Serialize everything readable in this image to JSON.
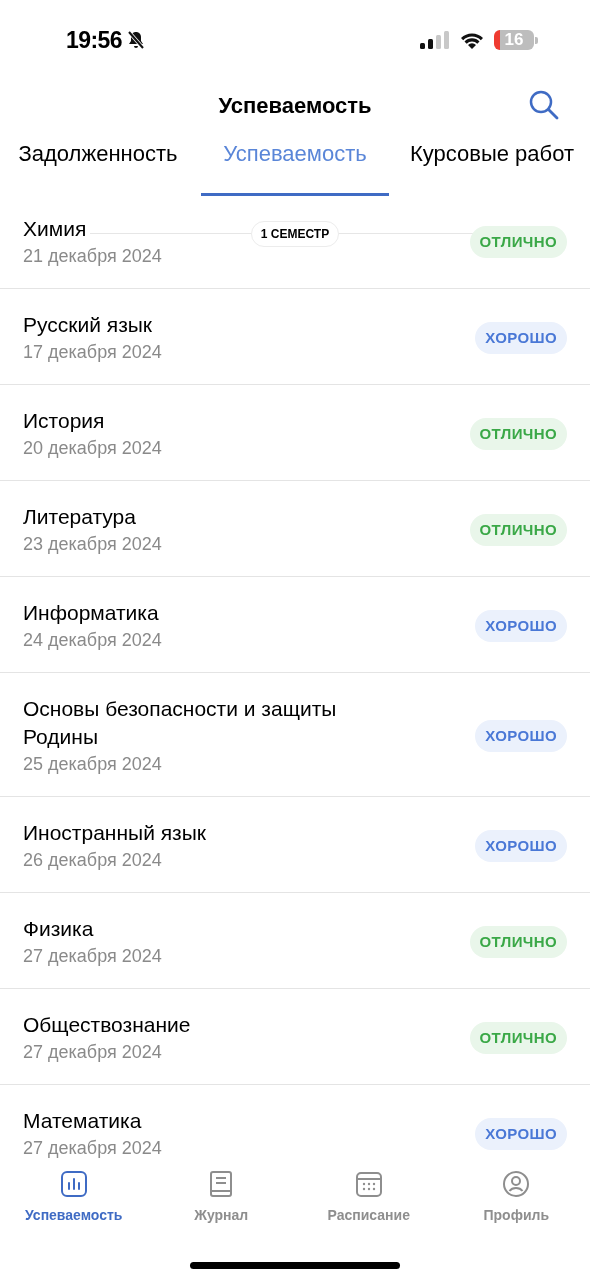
{
  "status_bar": {
    "time": "19:56",
    "battery": "16"
  },
  "header": {
    "title": "Успеваемость"
  },
  "tabs": [
    {
      "label": "Задолженность",
      "selected": false
    },
    {
      "label": "Успеваемость",
      "selected": true
    },
    {
      "label": "Курсовые работ",
      "selected": false
    }
  ],
  "section": {
    "label": "1 СЕМЕСТР"
  },
  "rows": [
    {
      "subject": "Химия",
      "date": "21 декабря 2024",
      "grade": "ОТЛИЧНО",
      "kind": "excellent"
    },
    {
      "subject": "Русский язык",
      "date": "17 декабря 2024",
      "grade": "ХОРОШО",
      "kind": "good"
    },
    {
      "subject": "История",
      "date": "20 декабря 2024",
      "grade": "ОТЛИЧНО",
      "kind": "excellent"
    },
    {
      "subject": "Литература",
      "date": "23 декабря 2024",
      "grade": "ОТЛИЧНО",
      "kind": "excellent"
    },
    {
      "subject": "Информатика",
      "date": "24 декабря 2024",
      "grade": "ХОРОШО",
      "kind": "good"
    },
    {
      "subject": "Основы безопасности и защиты Родины",
      "date": "25 декабря 2024",
      "grade": "ХОРОШО",
      "kind": "good"
    },
    {
      "subject": "Иностранный язык",
      "date": "26 декабря 2024",
      "grade": "ХОРОШО",
      "kind": "good"
    },
    {
      "subject": "Физика",
      "date": "27 декабря 2024",
      "grade": "ОТЛИЧНО",
      "kind": "excellent"
    },
    {
      "subject": "Обществознание",
      "date": "27 декабря 2024",
      "grade": "ОТЛИЧНО",
      "kind": "excellent"
    },
    {
      "subject": "Математика",
      "date": "27 декабря 2024",
      "grade": "ХОРОШО",
      "kind": "good"
    }
  ],
  "bottom_nav": [
    {
      "label": "Успеваемость",
      "kind": "chart",
      "selected": true
    },
    {
      "label": "Журнал",
      "kind": "book",
      "selected": false
    },
    {
      "label": "Расписание",
      "kind": "calendar",
      "selected": false
    },
    {
      "label": "Профиль",
      "kind": "profile",
      "selected": false
    }
  ]
}
